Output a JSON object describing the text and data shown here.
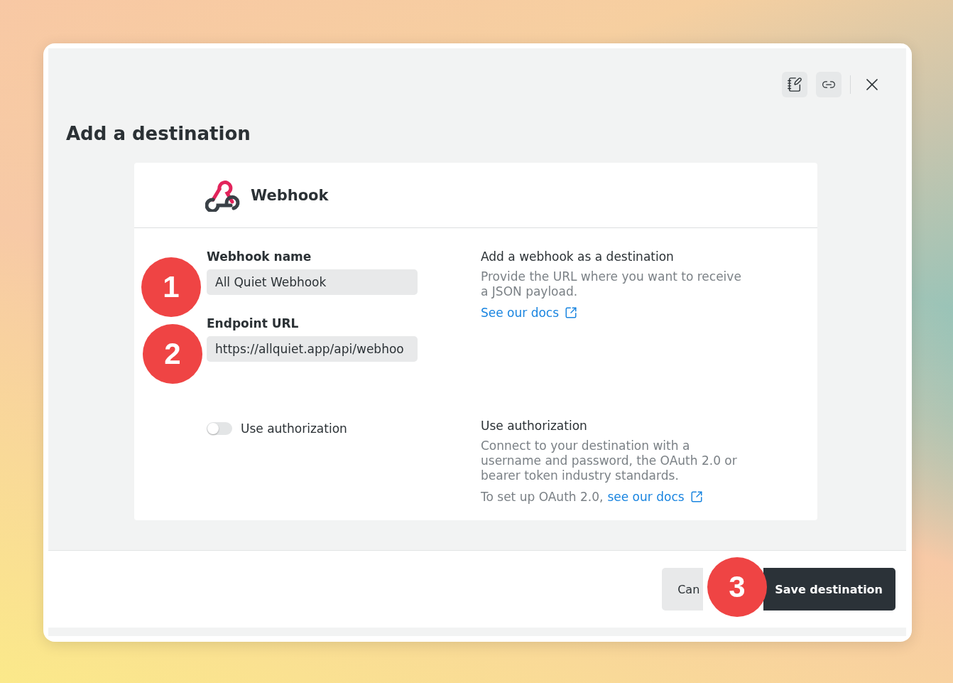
{
  "dialog": {
    "title": "Add a destination",
    "toolbar": [
      {
        "kind": "notes"
      },
      {
        "kind": "link"
      },
      {
        "kind": "close"
      }
    ],
    "integration": {
      "name": "Webhook"
    },
    "fields": [
      {
        "label": "Webhook name",
        "value": "All Quiet Webhook"
      },
      {
        "label": "Endpoint URL",
        "value": "https://allquiet.app/api/webhoo"
      }
    ],
    "info": {
      "title": "Add a webhook as a destination",
      "text": "Provide the URL where you want to receive a JSON payload.",
      "link": "See our docs"
    },
    "authorization": {
      "toggle_label": "Use authorization",
      "on": false,
      "title": "Use authorization",
      "text": "Connect to your destination with a username and password, the OAuth 2.0 or bearer token industry standards.",
      "link_prefix": "To set up OAuth 2.0,",
      "link": "see our docs"
    },
    "buttons": {
      "cancel": "Can",
      "save": "Save destination"
    }
  },
  "annotations": [
    "1",
    "2",
    "3"
  ]
}
